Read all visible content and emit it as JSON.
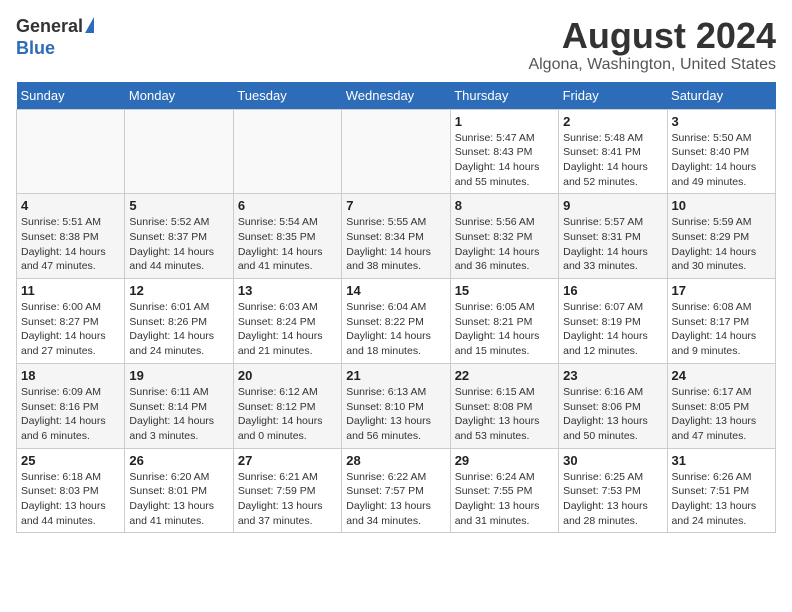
{
  "header": {
    "logo_general": "General",
    "logo_blue": "Blue",
    "month_title": "August 2024",
    "location": "Algona, Washington, United States"
  },
  "days_of_week": [
    "Sunday",
    "Monday",
    "Tuesday",
    "Wednesday",
    "Thursday",
    "Friday",
    "Saturday"
  ],
  "weeks": [
    {
      "row": 1,
      "days": [
        {
          "number": "",
          "info": ""
        },
        {
          "number": "",
          "info": ""
        },
        {
          "number": "",
          "info": ""
        },
        {
          "number": "",
          "info": ""
        },
        {
          "number": "1",
          "info": "Sunrise: 5:47 AM\nSunset: 8:43 PM\nDaylight: 14 hours\nand 55 minutes."
        },
        {
          "number": "2",
          "info": "Sunrise: 5:48 AM\nSunset: 8:41 PM\nDaylight: 14 hours\nand 52 minutes."
        },
        {
          "number": "3",
          "info": "Sunrise: 5:50 AM\nSunset: 8:40 PM\nDaylight: 14 hours\nand 49 minutes."
        }
      ]
    },
    {
      "row": 2,
      "days": [
        {
          "number": "4",
          "info": "Sunrise: 5:51 AM\nSunset: 8:38 PM\nDaylight: 14 hours\nand 47 minutes."
        },
        {
          "number": "5",
          "info": "Sunrise: 5:52 AM\nSunset: 8:37 PM\nDaylight: 14 hours\nand 44 minutes."
        },
        {
          "number": "6",
          "info": "Sunrise: 5:54 AM\nSunset: 8:35 PM\nDaylight: 14 hours\nand 41 minutes."
        },
        {
          "number": "7",
          "info": "Sunrise: 5:55 AM\nSunset: 8:34 PM\nDaylight: 14 hours\nand 38 minutes."
        },
        {
          "number": "8",
          "info": "Sunrise: 5:56 AM\nSunset: 8:32 PM\nDaylight: 14 hours\nand 36 minutes."
        },
        {
          "number": "9",
          "info": "Sunrise: 5:57 AM\nSunset: 8:31 PM\nDaylight: 14 hours\nand 33 minutes."
        },
        {
          "number": "10",
          "info": "Sunrise: 5:59 AM\nSunset: 8:29 PM\nDaylight: 14 hours\nand 30 minutes."
        }
      ]
    },
    {
      "row": 3,
      "days": [
        {
          "number": "11",
          "info": "Sunrise: 6:00 AM\nSunset: 8:27 PM\nDaylight: 14 hours\nand 27 minutes."
        },
        {
          "number": "12",
          "info": "Sunrise: 6:01 AM\nSunset: 8:26 PM\nDaylight: 14 hours\nand 24 minutes."
        },
        {
          "number": "13",
          "info": "Sunrise: 6:03 AM\nSunset: 8:24 PM\nDaylight: 14 hours\nand 21 minutes."
        },
        {
          "number": "14",
          "info": "Sunrise: 6:04 AM\nSunset: 8:22 PM\nDaylight: 14 hours\nand 18 minutes."
        },
        {
          "number": "15",
          "info": "Sunrise: 6:05 AM\nSunset: 8:21 PM\nDaylight: 14 hours\nand 15 minutes."
        },
        {
          "number": "16",
          "info": "Sunrise: 6:07 AM\nSunset: 8:19 PM\nDaylight: 14 hours\nand 12 minutes."
        },
        {
          "number": "17",
          "info": "Sunrise: 6:08 AM\nSunset: 8:17 PM\nDaylight: 14 hours\nand 9 minutes."
        }
      ]
    },
    {
      "row": 4,
      "days": [
        {
          "number": "18",
          "info": "Sunrise: 6:09 AM\nSunset: 8:16 PM\nDaylight: 14 hours\nand 6 minutes."
        },
        {
          "number": "19",
          "info": "Sunrise: 6:11 AM\nSunset: 8:14 PM\nDaylight: 14 hours\nand 3 minutes."
        },
        {
          "number": "20",
          "info": "Sunrise: 6:12 AM\nSunset: 8:12 PM\nDaylight: 14 hours\nand 0 minutes."
        },
        {
          "number": "21",
          "info": "Sunrise: 6:13 AM\nSunset: 8:10 PM\nDaylight: 13 hours\nand 56 minutes."
        },
        {
          "number": "22",
          "info": "Sunrise: 6:15 AM\nSunset: 8:08 PM\nDaylight: 13 hours\nand 53 minutes."
        },
        {
          "number": "23",
          "info": "Sunrise: 6:16 AM\nSunset: 8:06 PM\nDaylight: 13 hours\nand 50 minutes."
        },
        {
          "number": "24",
          "info": "Sunrise: 6:17 AM\nSunset: 8:05 PM\nDaylight: 13 hours\nand 47 minutes."
        }
      ]
    },
    {
      "row": 5,
      "days": [
        {
          "number": "25",
          "info": "Sunrise: 6:18 AM\nSunset: 8:03 PM\nDaylight: 13 hours\nand 44 minutes."
        },
        {
          "number": "26",
          "info": "Sunrise: 6:20 AM\nSunset: 8:01 PM\nDaylight: 13 hours\nand 41 minutes."
        },
        {
          "number": "27",
          "info": "Sunrise: 6:21 AM\nSunset: 7:59 PM\nDaylight: 13 hours\nand 37 minutes."
        },
        {
          "number": "28",
          "info": "Sunrise: 6:22 AM\nSunset: 7:57 PM\nDaylight: 13 hours\nand 34 minutes."
        },
        {
          "number": "29",
          "info": "Sunrise: 6:24 AM\nSunset: 7:55 PM\nDaylight: 13 hours\nand 31 minutes."
        },
        {
          "number": "30",
          "info": "Sunrise: 6:25 AM\nSunset: 7:53 PM\nDaylight: 13 hours\nand 28 minutes."
        },
        {
          "number": "31",
          "info": "Sunrise: 6:26 AM\nSunset: 7:51 PM\nDaylight: 13 hours\nand 24 minutes."
        }
      ]
    }
  ]
}
